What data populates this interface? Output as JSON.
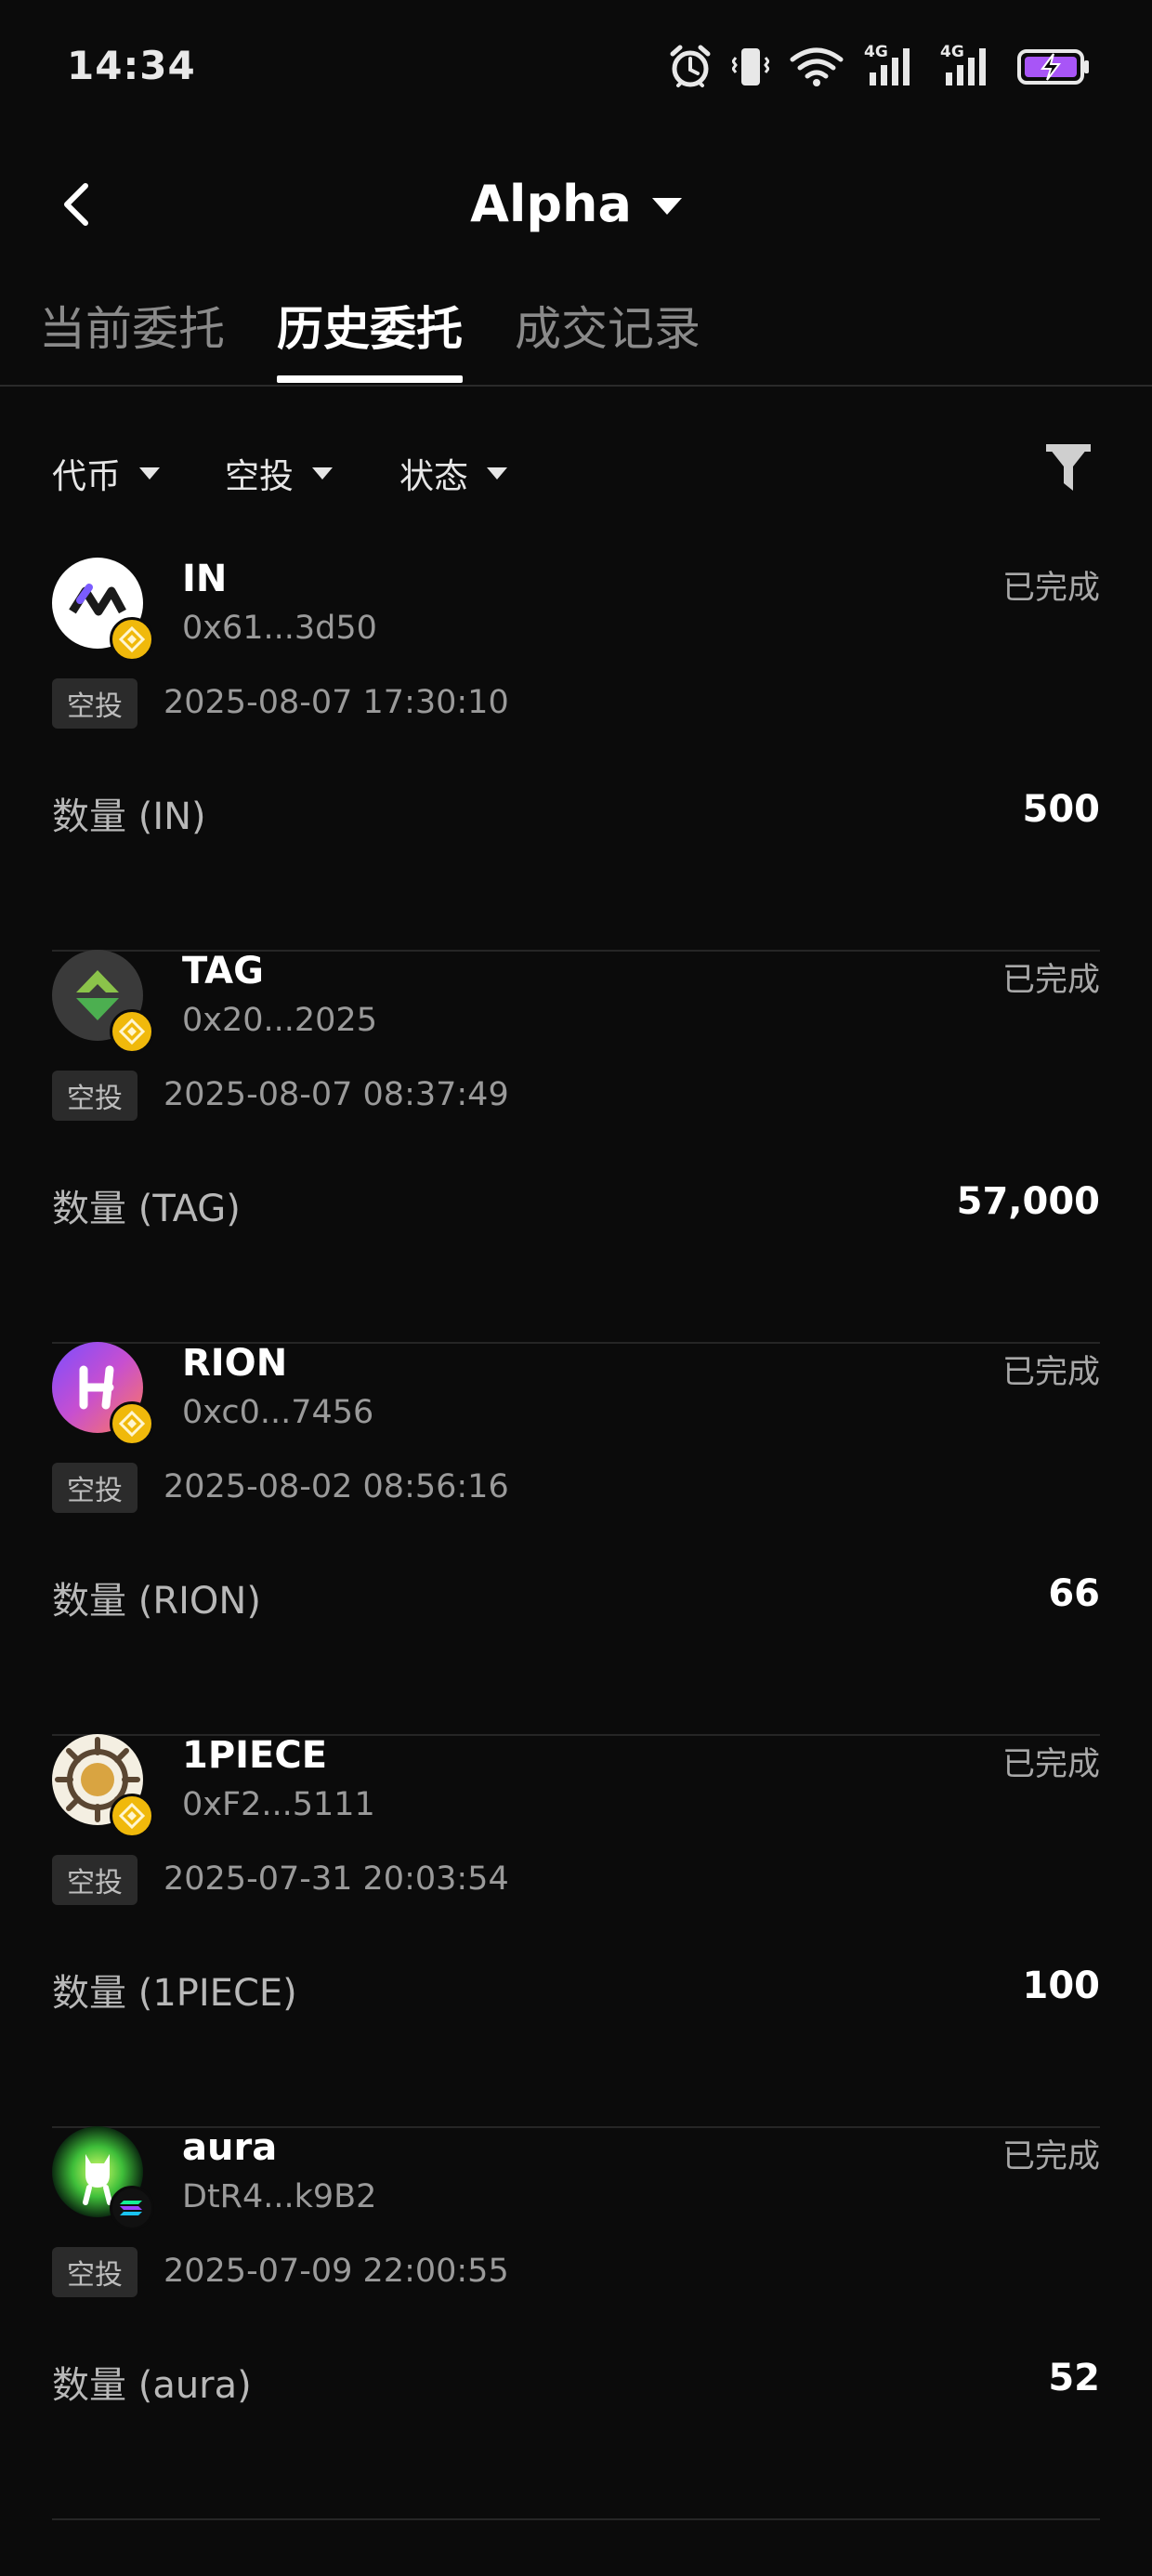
{
  "status_bar": {
    "time": "14:34",
    "icons": [
      "alarm-icon",
      "vibrate-icon",
      "wifi-icon",
      "signal-4g-icon",
      "signal-4g-icon",
      "battery-charging-icon"
    ],
    "network_label_1": "4G",
    "network_label_2": "4G"
  },
  "header": {
    "title": "Alpha",
    "back_icon": "chevron-left-icon",
    "dropdown_icon": "caret-down-icon"
  },
  "tabs": [
    {
      "label": "当前委托",
      "active": false
    },
    {
      "label": "历史委托",
      "active": true
    },
    {
      "label": "成交记录",
      "active": false
    }
  ],
  "filters": {
    "token": "代币",
    "type": "空投",
    "status": "状态",
    "filter_icon": "funnel-icon"
  },
  "records": [
    {
      "symbol": "IN",
      "address": "0x61...3d50",
      "status": "已完成",
      "tag": "空投",
      "datetime": "2025-08-07 17:30:10",
      "qty_label": "数量 (IN)",
      "qty": "500",
      "chain": "bnb"
    },
    {
      "symbol": "TAG",
      "address": "0x20...2025",
      "status": "已完成",
      "tag": "空投",
      "datetime": "2025-08-07 08:37:49",
      "qty_label": "数量 (TAG)",
      "qty": "57,000",
      "chain": "bnb"
    },
    {
      "symbol": "RION",
      "address": "0xc0...7456",
      "status": "已完成",
      "tag": "空投",
      "datetime": "2025-08-02 08:56:16",
      "qty_label": "数量 (RION)",
      "qty": "66",
      "chain": "bnb"
    },
    {
      "symbol": "1PIECE",
      "address": "0xF2...5111",
      "status": "已完成",
      "tag": "空投",
      "datetime": "2025-07-31 20:03:54",
      "qty_label": "数量 (1PIECE)",
      "qty": "100",
      "chain": "bnb"
    },
    {
      "symbol": "aura",
      "address": "DtR4...k9B2",
      "status": "已完成",
      "tag": "空投",
      "datetime": "2025-07-09 22:00:55",
      "qty_label": "数量 (aura)",
      "qty": "52",
      "chain": "solana"
    }
  ],
  "colors": {
    "background": "#0b0b0b",
    "bnb_badge": "#f0b90b",
    "battery_fill": "#a855f7",
    "divider": "#262626"
  }
}
